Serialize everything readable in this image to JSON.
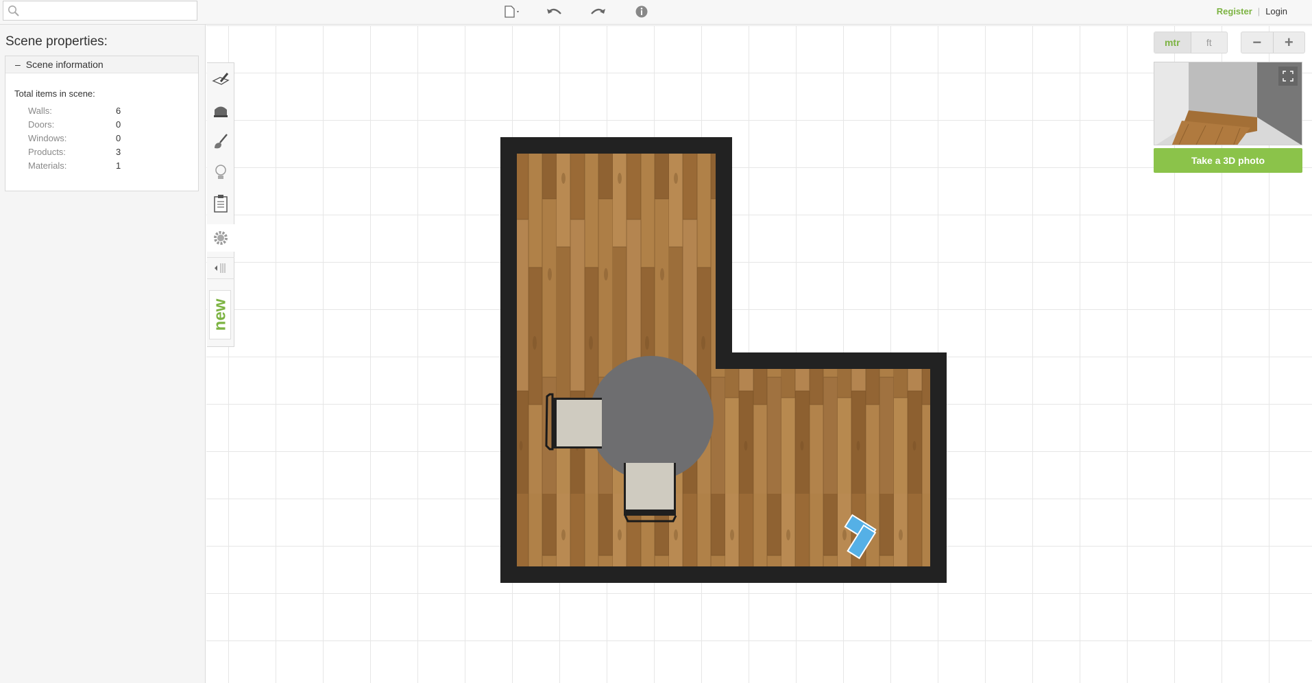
{
  "search": {
    "placeholder": ""
  },
  "toolbar": {
    "icons": [
      "new-document-icon",
      "undo-icon",
      "redo-icon",
      "help-icon"
    ]
  },
  "auth": {
    "register_label": "Register",
    "login_label": "Login",
    "separator": "|"
  },
  "left_panel": {
    "title": "Scene properties:",
    "section": {
      "collapse_symbol": "–",
      "label": "Scene information",
      "total_label": "Total items in scene:",
      "stats": [
        {
          "key": "Walls:",
          "value": "6"
        },
        {
          "key": "Doors:",
          "value": "0"
        },
        {
          "key": "Windows:",
          "value": "0"
        },
        {
          "key": "Products:",
          "value": "3"
        },
        {
          "key": "Materials:",
          "value": "1"
        }
      ]
    }
  },
  "tools": {
    "items": [
      "draw-walls-icon",
      "furniture-icon",
      "paint-brush-icon",
      "light-bulb-icon",
      "clipboard-icon",
      "settings-gear-icon"
    ],
    "new_label": "new"
  },
  "units": {
    "metric_label": "mtr",
    "imperial_label": "ft",
    "active": "mtr"
  },
  "zoom": {
    "out_label": "−",
    "in_label": "+"
  },
  "preview": {
    "photo_button_label": "Take a 3D photo"
  },
  "colors": {
    "accent": "#7cb342",
    "button_green": "#8bc34a",
    "wall": "#222222",
    "floor": "#a0703e",
    "rug": "#6e6e70"
  }
}
